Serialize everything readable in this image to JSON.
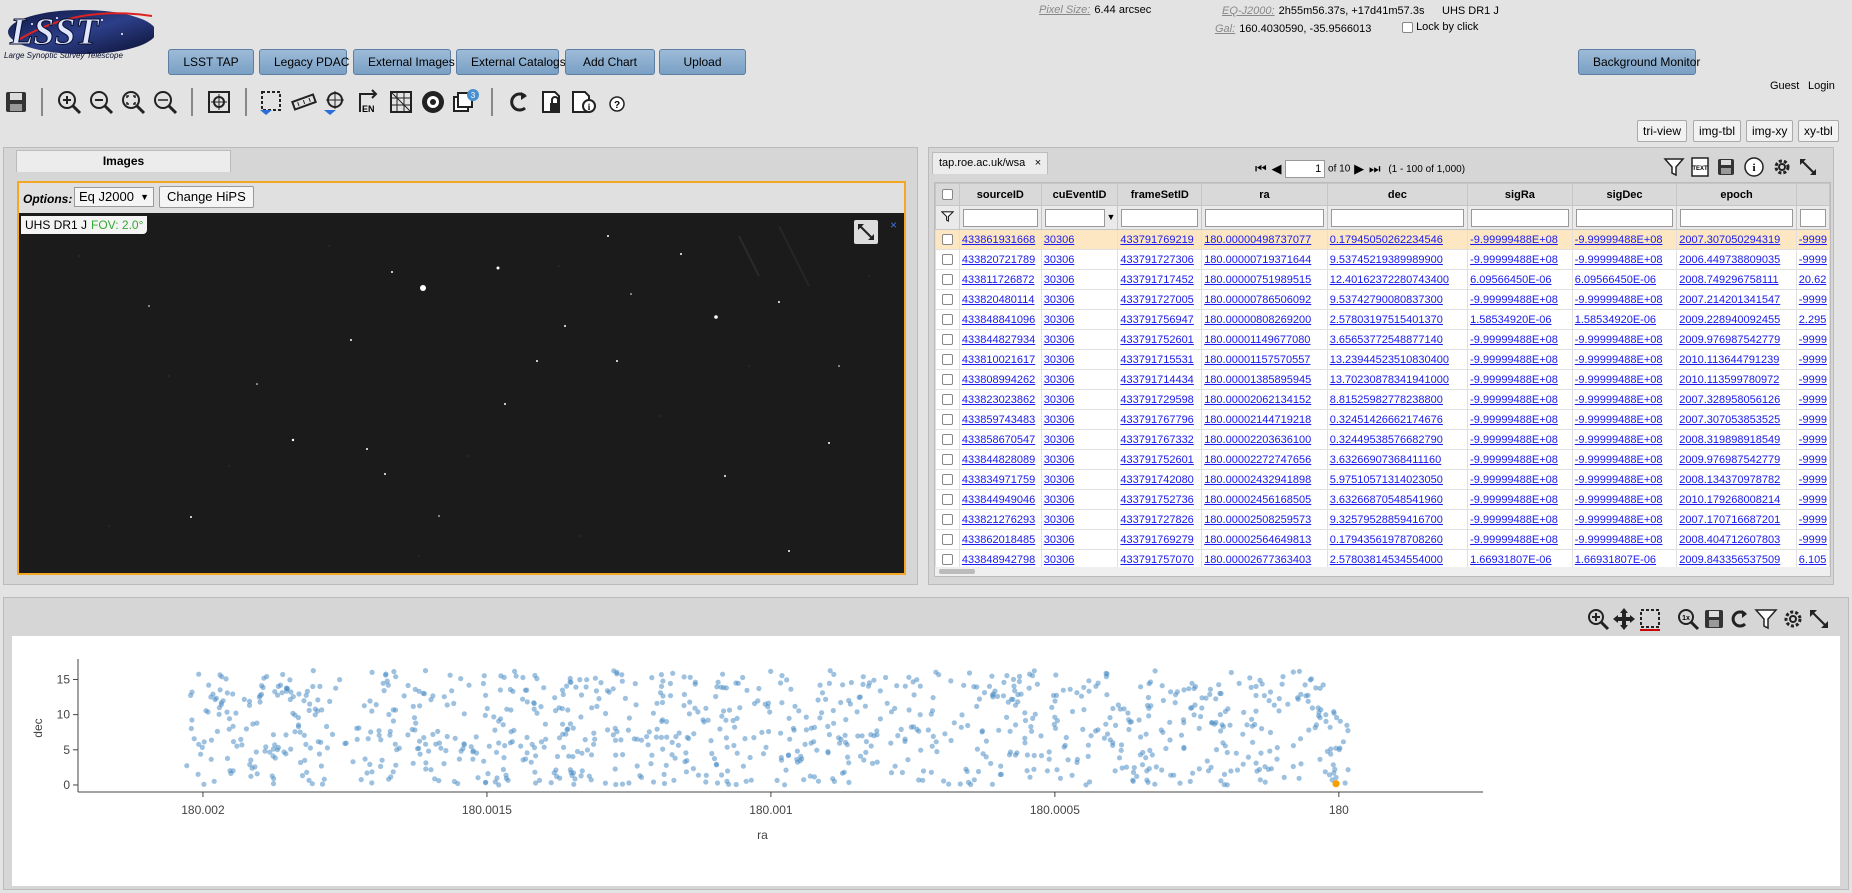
{
  "header": {
    "logo_text": "LSST",
    "logo_subtitle": "Large Synoptic Survey Telescope",
    "menu": [
      "LSST TAP",
      "Legacy PDAC",
      "External Images",
      "External Catalogs",
      "Add Chart",
      "Upload"
    ],
    "background_monitor": "Background Monitor",
    "pixel_size_label": "Pixel Size:",
    "pixel_size_value": "6.44 arcsec",
    "eq_label": "EQ-J2000:",
    "eq_value": "2h55m56.37s, +17d41m57.3s",
    "image_name": "UHS DR1 J",
    "gal_label": "Gal:",
    "gal_value": "160.4030590, -35.9566013",
    "lock_label": "Lock by click",
    "guest": "Guest",
    "login": "Login"
  },
  "layout_buttons": [
    "tri-view",
    "img-tbl",
    "img-xy",
    "xy-tbl"
  ],
  "toolbar_badge": "3",
  "images_panel": {
    "tab": "Images",
    "options_label": "Options:",
    "coord_select": "Eq J2000",
    "hips_button": "Change HiPS",
    "image_title": "UHS DR1 J",
    "fov": "FOV: 2.0°",
    "close_glyph": "×"
  },
  "table_panel": {
    "tab": "tap.roe.ac.uk/wsa",
    "tab_close": "×",
    "page_value": "1",
    "page_of": "of 10",
    "range": "(1 - 100 of 1,000)",
    "columns": [
      "sourceID",
      "cuEventID",
      "frameSetID",
      "ra",
      "dec",
      "sigRa",
      "sigDec",
      "epoch"
    ],
    "rows": [
      [
        "433861931668",
        "30306",
        "433791769219",
        "180.00000498737077",
        "0.17945050262234546",
        "-9.99999488E+08",
        "-9.99999488E+08",
        "2007.307050294319",
        "-9999"
      ],
      [
        "433820721789",
        "30306",
        "433791727306",
        "180.00000719371644",
        "9.53745219389989900",
        "-9.99999488E+08",
        "-9.99999488E+08",
        "2006.449738809035",
        "-9999"
      ],
      [
        "433811726872",
        "30306",
        "433791717452",
        "180.00000751989515",
        "12.40162372280743400",
        "6.09566450E-06",
        "6.09566450E-06",
        "2008.749296758111",
        "20.62"
      ],
      [
        "433820480114",
        "30306",
        "433791727005",
        "180.00000786506092",
        "9.53742790080837300",
        "-9.99999488E+08",
        "-9.99999488E+08",
        "2007.214201341547",
        "-9999"
      ],
      [
        "433848841096",
        "30306",
        "433791756947",
        "180.00000808269200",
        "2.57803197515401370",
        "1.58534920E-06",
        "1.58534920E-06",
        "2009.228940092455",
        "2.295"
      ],
      [
        "433844827934",
        "30306",
        "433791752601",
        "180.00001149677080",
        "3.65653772548877140",
        "-9.99999488E+08",
        "-9.99999488E+08",
        "2009.976987542779",
        "-9999"
      ],
      [
        "433810021617",
        "30306",
        "433791715531",
        "180.00001157570557",
        "13.23944523510830400",
        "-9.99999488E+08",
        "-9.99999488E+08",
        "2010.113644791239",
        "-9999"
      ],
      [
        "433808994262",
        "30306",
        "433791714434",
        "180.00001385895945",
        "13.70230878341941000",
        "-9.99999488E+08",
        "-9.99999488E+08",
        "2010.113599780972",
        "-9999"
      ],
      [
        "433823023862",
        "30306",
        "433791729598",
        "180.00002062134152",
        "8.81525982778238800",
        "-9.99999488E+08",
        "-9.99999488E+08",
        "2007.328958056126",
        "-9999"
      ],
      [
        "433859743483",
        "30306",
        "433791767796",
        "180.00002144719218",
        "0.32451426662174676",
        "-9.99999488E+08",
        "-9.99999488E+08",
        "2007.307053853525",
        "-9999"
      ],
      [
        "433858670547",
        "30306",
        "433791767332",
        "180.00002203636100",
        "0.32449538576682790",
        "-9.99999488E+08",
        "-9.99999488E+08",
        "2008.319898918549",
        "-9999"
      ],
      [
        "433844828089",
        "30306",
        "433791752601",
        "180.00002272747656",
        "3.63266907368411160",
        "-9.99999488E+08",
        "-9.99999488E+08",
        "2009.976987542779",
        "-9999"
      ],
      [
        "433834971759",
        "30306",
        "433791742080",
        "180.00002432941898",
        "5.97510571314023050",
        "-9.99999488E+08",
        "-9.99999488E+08",
        "2008.134370978782",
        "-9999"
      ],
      [
        "433844949046",
        "30306",
        "433791752736",
        "180.00002456168505",
        "3.63266870548541960",
        "-9.99999488E+08",
        "-9.99999488E+08",
        "2010.179268008214",
        "-9999"
      ],
      [
        "433821276293",
        "30306",
        "433791727826",
        "180.00002508259573",
        "9.32579528859416700",
        "-9.99999488E+08",
        "-9.99999488E+08",
        "2007.170716687201",
        "-9999"
      ],
      [
        "433862018485",
        "30306",
        "433791769279",
        "180.00002564649813",
        "0.17943561978708260",
        "-9.99999488E+08",
        "-9.99999488E+08",
        "2008.404712607803",
        "-9999"
      ],
      [
        "433848942798",
        "30306",
        "433791757070",
        "180.00002677363403",
        "2.57803814534554000",
        "1.66931807E-06",
        "1.66931807E-06",
        "2009.843356537509",
        "6.105"
      ]
    ]
  },
  "chart_data": {
    "type": "scatter",
    "title": "",
    "xlabel": "ra",
    "ylabel": "dec",
    "xlim": [
      180.00222,
      179.99988
    ],
    "ylim": [
      -1,
      17.2
    ],
    "x_ticks": [
      180.002,
      180.0015,
      180.001,
      180.0005,
      180
    ],
    "x_tick_labels": [
      "180.002",
      "180.0015",
      "180.001",
      "180.0005",
      "180"
    ],
    "y_ticks": [
      0,
      5,
      10,
      15
    ],
    "y_tick_labels": [
      "0",
      "5",
      "10",
      "15"
    ],
    "series_color": "#4c8ec4",
    "highlight_color": "#f5a000",
    "point_count": 1000,
    "x_range": [
      179.99998,
      180.00203
    ],
    "y_range": [
      0,
      16.3
    ],
    "highlight_point": [
      180.000005,
      0.18
    ]
  },
  "colors": {
    "accent_border": "#f5a623",
    "menu_button": "#8fb1d3",
    "link": "#1a1aee",
    "selected_row": "#fce7c2"
  }
}
